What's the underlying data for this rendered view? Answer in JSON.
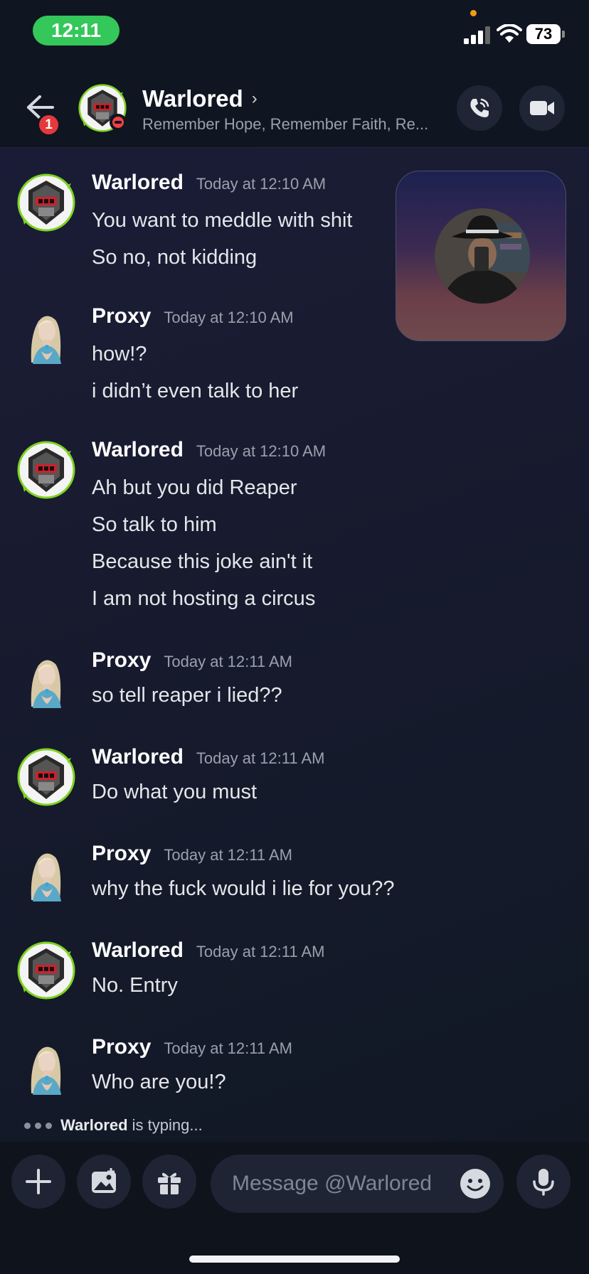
{
  "status_bar": {
    "time": "12:11",
    "battery": "73"
  },
  "header": {
    "back_badge": "1",
    "name": "Warlored",
    "chevron": "›",
    "subtitle": "Remember Hope, Remember Faith, Re...",
    "icons": [
      "back-arrow-icon",
      "phone-call-icon",
      "video-camera-icon"
    ]
  },
  "messages": [
    {
      "author": "Warlored",
      "time": "Today at 12:10 AM",
      "lines": [
        "You want to meddle with shit",
        "So no, not kidding"
      ]
    },
    {
      "author": "Proxy",
      "time": "Today at 12:10 AM",
      "lines": [
        "how!?",
        "i didn’t even talk to her"
      ]
    },
    {
      "author": "Warlored",
      "time": "Today at 12:10 AM",
      "lines": [
        "Ah but you did Reaper",
        "So talk to him",
        "Because this joke ain't it",
        "I am not hosting a circus"
      ]
    },
    {
      "author": "Proxy",
      "time": "Today at 12:11 AM",
      "lines": [
        "so tell reaper i lied??"
      ]
    },
    {
      "author": "Warlored",
      "time": "Today at 12:11 AM",
      "lines": [
        "Do what you must"
      ]
    },
    {
      "author": "Proxy",
      "time": "Today at 12:11 AM",
      "lines": [
        "why the fuck would i lie for you??"
      ]
    },
    {
      "author": "Warlored",
      "time": "Today at 12:11 AM",
      "lines": [
        "No. Entry"
      ]
    },
    {
      "author": "Proxy",
      "time": "Today at 12:11 AM",
      "lines": [
        "Who are you!?"
      ]
    }
  ],
  "typing": {
    "name": "Warlored",
    "suffix": " is typing..."
  },
  "composer": {
    "placeholder": "Message @Warlored",
    "icons": [
      "plus-icon",
      "image-icon",
      "gift-icon",
      "emoji-icon",
      "microphone-icon"
    ]
  },
  "colors": {
    "online_green": "#34c759",
    "dnd_red": "#f23f43",
    "badge_red": "#e5383b",
    "warlored_ring": "#7ed321"
  }
}
